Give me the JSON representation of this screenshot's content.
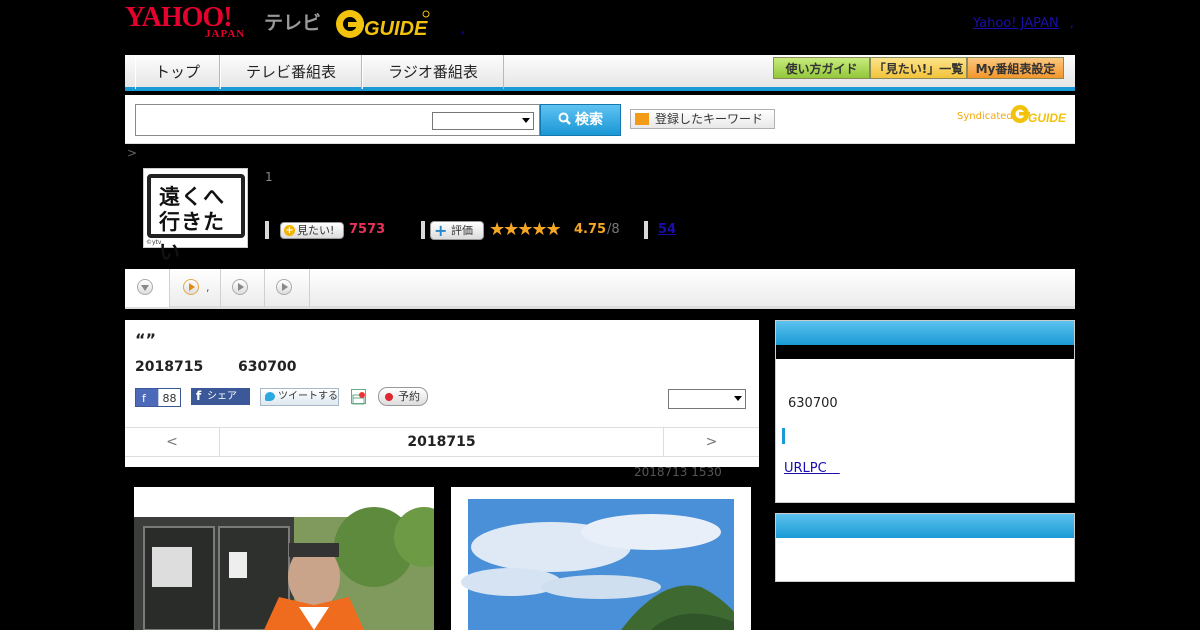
{
  "header": {
    "logo_yahoo": "YAHOO!",
    "logo_japan": "JAPAN",
    "logo_tv": "テレビ",
    "logo_gguide": "G GUIDE",
    "yahoo_japan_link": "Yahoo! JAPAN",
    "sep1": ",",
    "sep2": ","
  },
  "nav": {
    "tabs": [
      {
        "label": "トップ"
      },
      {
        "label": "テレビ番組表"
      },
      {
        "label": "ラジオ番組表"
      }
    ],
    "guide_buttons": [
      {
        "label": "使い方ガイド",
        "color": "#a6d34e"
      },
      {
        "label": "「見たい!」一覧",
        "color": "#f5c84a"
      },
      {
        "label": "My番組表設定",
        "color": "#f2a23a"
      }
    ]
  },
  "search": {
    "input_value": "",
    "select_value": "",
    "button_label": "検索",
    "keyword_button_label": "登録したキーワード",
    "syndicated_label": "Syndicated",
    "syndicated_logo": "GUIDE"
  },
  "breadcrumb": ">",
  "program": {
    "thumb_title_line1": "遠くへ",
    "thumb_title_line2": "行きたい",
    "thumb_copyright": "©ytv",
    "episode": "1",
    "mitai_label": "見たい!",
    "mitai_count": "7573",
    "hyoka_label": "評価",
    "stars": "★★★★★",
    "rating": "4.75",
    "rating_count": "/8",
    "review_link": "54"
  },
  "tabs_row": {
    "tab2_label": ","
  },
  "detail": {
    "title": "“”",
    "date": "2018715",
    "time": "630700",
    "fb_like_label": "f",
    "fb_like_count": "88",
    "fb_share_label": "シェア",
    "tweet_label": "ツイートする",
    "reserve_label": "予約",
    "select_value": "",
    "pager_prev": "<",
    "pager_current": "2018715",
    "pager_next": ">"
  },
  "updated": "2018713  1530",
  "side": {
    "time": "630700",
    "link": "URLPC　"
  },
  "colors": {
    "accent_blue": "#1a9bd7",
    "mitai_red": "#e8325a",
    "star_orange": "#f5a623",
    "link_blue": "#1a0dab"
  }
}
